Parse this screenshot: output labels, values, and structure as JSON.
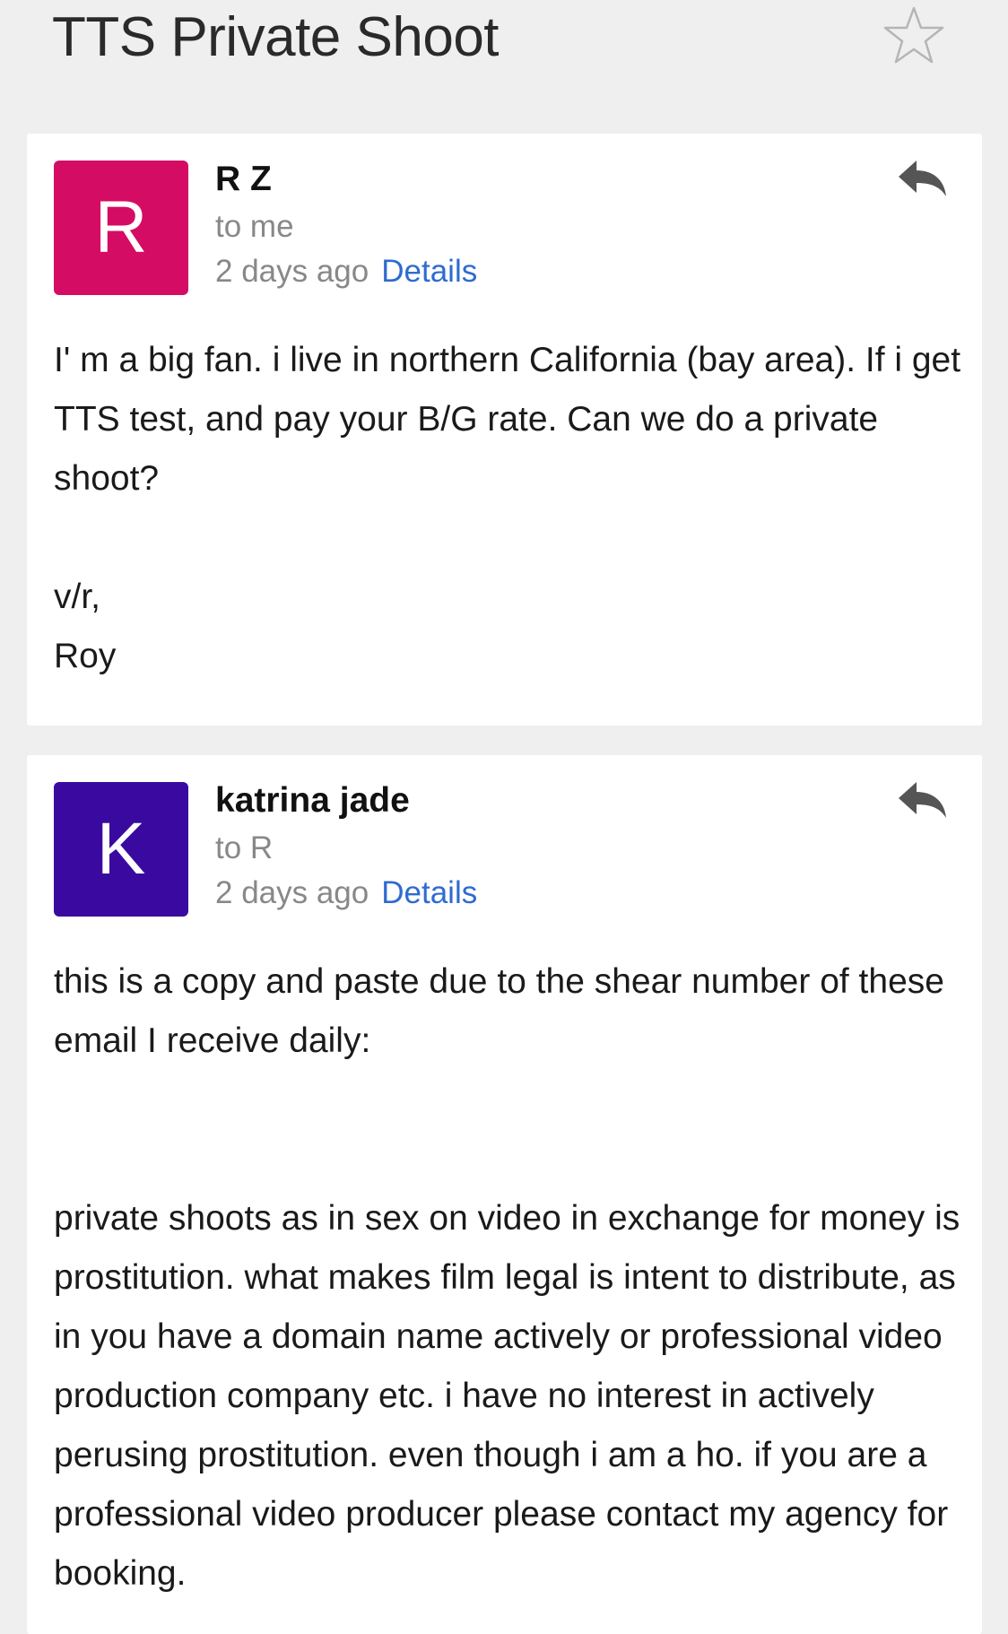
{
  "thread": {
    "title": "TTS Private Shoot",
    "star_icon": "star-outline-icon"
  },
  "messages": [
    {
      "avatar_letter": "R",
      "avatar_color": "#d40c64",
      "sender": "R Z",
      "recipient": "to me",
      "time": "2 days ago",
      "details_label": "Details",
      "reply_icon": "reply-icon",
      "body_paragraphs": [
        "I' m a big fan. i live in northern California (bay area). If i get TTS test, and pay your B/G rate. Can we do a private shoot?"
      ],
      "signature_lines": [
        "v/r,",
        "Roy"
      ]
    },
    {
      "avatar_letter": "K",
      "avatar_color": "#3a0aa0",
      "sender": "katrina jade",
      "recipient": "to R",
      "time": "2 days ago",
      "details_label": "Details",
      "reply_icon": "reply-icon",
      "body_paragraphs": [
        "this is a copy and paste due to the shear number of these email I receive daily:",
        "private shoots as in sex on video in exchange for money is prostitution. what makes film legal is intent to distribute, as in you have a domain name actively or professional video production company etc. i have no interest in actively perusing prostitution. even though i am a ho. if you are a professional video producer please contact my agency for booking."
      ]
    }
  ]
}
